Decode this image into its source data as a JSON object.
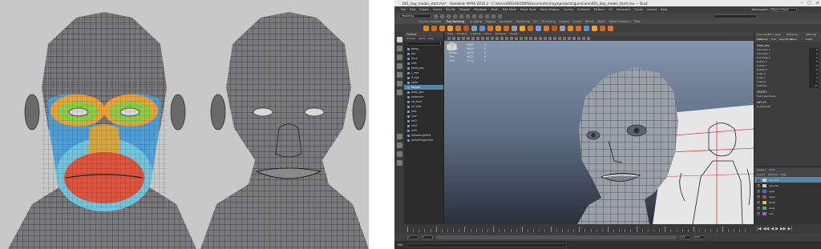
{
  "window": {
    "title": "001_boy_model_start.ma* - Autodesk MAYA 2016.2 - C:\\Users\\ROGAEOD0f\\Documents\\maya\\projects\\gumicane\\001_boy_model_Start.ma --- Bust"
  },
  "menubar": {
    "items": [
      "File",
      "Edit",
      "Create",
      "Select",
      "Modify",
      "Display",
      "Windows",
      "Mesh",
      "Edit Mesh",
      "Mesh Tools",
      "Mesh Display",
      "Curves",
      "Surfaces",
      "Deform",
      "UV",
      "Generate",
      "Cache",
      "Arnold",
      "Help"
    ],
    "workspace_label": "Workspace",
    "workspace_value": "Maya Classic"
  },
  "statusline": {
    "mode": "Modeling"
  },
  "shelf": {
    "tabs": [
      "Curves / Surfaces",
      "Poly Modeling",
      "Sculpting",
      "Rigging",
      "Animation",
      "Rendering",
      "FX",
      "FX Caching",
      "Custom",
      "Arnold",
      "Bifrost",
      "MASH",
      "Motion Graphics",
      "XGen"
    ],
    "active_tab": "Poly Modeling",
    "icon_colors": [
      "#e0892c",
      "#c86a28",
      "#d97a31",
      "#e6a43b",
      "#cf6f2d",
      "#b95a26",
      "#7aa0c8",
      "#6a8fb8",
      "#d47530",
      "#e0892c",
      "#cf6f2d",
      "#9c9c9c",
      "#e6a43b",
      "#c86a28",
      "#7aa0c8",
      "#d97a31",
      "#b95a26",
      "#9c9c9c",
      "#e0892c",
      "#cf6f2d",
      "#6a8fb8",
      "#e6a43b",
      "#c86a28",
      "#d47530"
    ]
  },
  "outliner": {
    "title": "Outliner",
    "menu": [
      "Display",
      "Show",
      "Help"
    ],
    "items": [
      "persp",
      "top",
      "front",
      "side",
      "head_geo",
      "L_eye",
      "R_eye",
      "teeth",
      "tongue",
      "body_geo",
      "reference",
      "ref_front",
      "ref_side",
      "set1",
      "set2",
      "set3",
      "set4",
      "set5",
      "defaultLightSet",
      "defaultObjectSet"
    ],
    "selected_index": 8
  },
  "viewport": {
    "menu": [
      "View",
      "Shading",
      "Lighting",
      "Show",
      "Renderer",
      "Panels"
    ],
    "hud": [
      {
        "label": "Verts:",
        "a": "2834",
        "b": "0"
      },
      {
        "label": "Edges:",
        "a": "5648",
        "b": "0"
      },
      {
        "label": "Faces:",
        "a": "2816",
        "b": "0"
      },
      {
        "label": "Tris:",
        "a": "5632",
        "b": "0"
      },
      {
        "label": "UVs:",
        "a": "3170",
        "b": "0"
      }
    ]
  },
  "channelbox": {
    "tabs": [
      "Channel Box / Layer Editor",
      "Modeling Toolkit",
      "Attribute Editor"
    ],
    "menu": [
      "Channels",
      "Edit",
      "Object",
      "Show"
    ],
    "object": "head_geo",
    "channels": [
      {
        "name": "Translate X",
        "value": "0"
      },
      {
        "name": "Translate Y",
        "value": "0"
      },
      {
        "name": "Translate Z",
        "value": "0"
      },
      {
        "name": "Rotate X",
        "value": "0"
      },
      {
        "name": "Rotate Y",
        "value": "0"
      },
      {
        "name": "Rotate Z",
        "value": "0"
      },
      {
        "name": "Scale X",
        "value": "1"
      },
      {
        "name": "Scale Y",
        "value": "1"
      },
      {
        "name": "Scale Z",
        "value": "1"
      },
      {
        "name": "Visibility",
        "value": "on"
      }
    ],
    "shapes_label": "SHAPES",
    "shape_name": "head_geoShape",
    "inputs_label": "INPUTS",
    "input_name": "polyTweak1"
  },
  "layers": {
    "tabs": [
      "Display",
      "Anim"
    ],
    "menu": [
      "Layers",
      "Options",
      "Help"
    ],
    "items": [
      {
        "name": "ref_front",
        "vis": "V",
        "color": "#c9c9c9"
      },
      {
        "name": "ref_side",
        "vis": "V",
        "color": "#c9c9c9"
      },
      {
        "name": "eyes",
        "vis": "V",
        "color": "#4a70c0"
      },
      {
        "name": "head",
        "vis": "V",
        "color": "#b04a4a"
      },
      {
        "name": "teeth",
        "vis": "V",
        "color": "#d8c24a"
      },
      {
        "name": "body",
        "vis": "V",
        "color": "#4ab06a"
      },
      {
        "name": "hair",
        "vis": "V",
        "color": "#9a6ac0"
      }
    ],
    "selected_index": 0
  },
  "timeline": {
    "start": "1",
    "end": "120",
    "range_start": "1",
    "range_end": "200",
    "buttons": [
      "|◀",
      "◀◀",
      "◀",
      "▶",
      "▶▶",
      "▶|"
    ]
  },
  "cmdline": {
    "label": "MEL"
  },
  "reference": {
    "loop_colors": {
      "eye": "#f0a030",
      "eye_inner": "#8ecb45",
      "nose": "#d8a53a",
      "mouth_ring": "#6fc4e0",
      "mouth": "#e0523a",
      "mouth_outer": "#4aa0dd"
    }
  }
}
